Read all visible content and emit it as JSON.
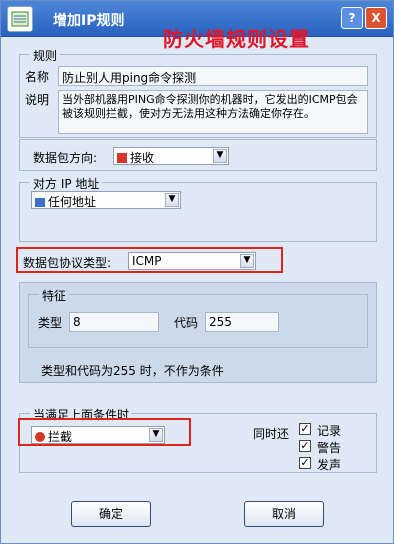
{
  "window": {
    "title": "增加IP规则",
    "annotation": "防火墙规则设置",
    "help_label": "?",
    "close_label": "X"
  },
  "rule": {
    "legend": "规则",
    "name_label": "名称",
    "name_value": "防止别人用ping命令探测",
    "desc_label": "说明",
    "desc_value": "当外部机器用PING命令探测你的机器时，它发出的ICMP包会被该规则拦截，使对方无法用这种方法确定你存在。"
  },
  "direction": {
    "label": "数据包方向:",
    "value": "接收"
  },
  "remote_ip": {
    "legend": "对方 IP 地址",
    "value": "任何地址"
  },
  "protocol": {
    "label": "数据包协议类型:",
    "value": "ICMP"
  },
  "feature": {
    "legend": "特征",
    "type_label": "类型",
    "type_value": "8",
    "code_label": "代码",
    "code_value": "255",
    "note": "类型和代码为255  时，不作为条件"
  },
  "action": {
    "legend": "当满足上面条件时",
    "value": "拦截",
    "also_label": "同时还",
    "options": [
      {
        "label": "记录",
        "checked": true
      },
      {
        "label": "警告",
        "checked": true
      },
      {
        "label": "发声",
        "checked": true
      }
    ]
  },
  "buttons": {
    "ok": "确定",
    "cancel": "取消"
  },
  "colors": {
    "titlebar": "#2a63bf",
    "annotation": "#e1142a",
    "highlight_box": "#e2231a",
    "background": "#dfe9f5"
  }
}
